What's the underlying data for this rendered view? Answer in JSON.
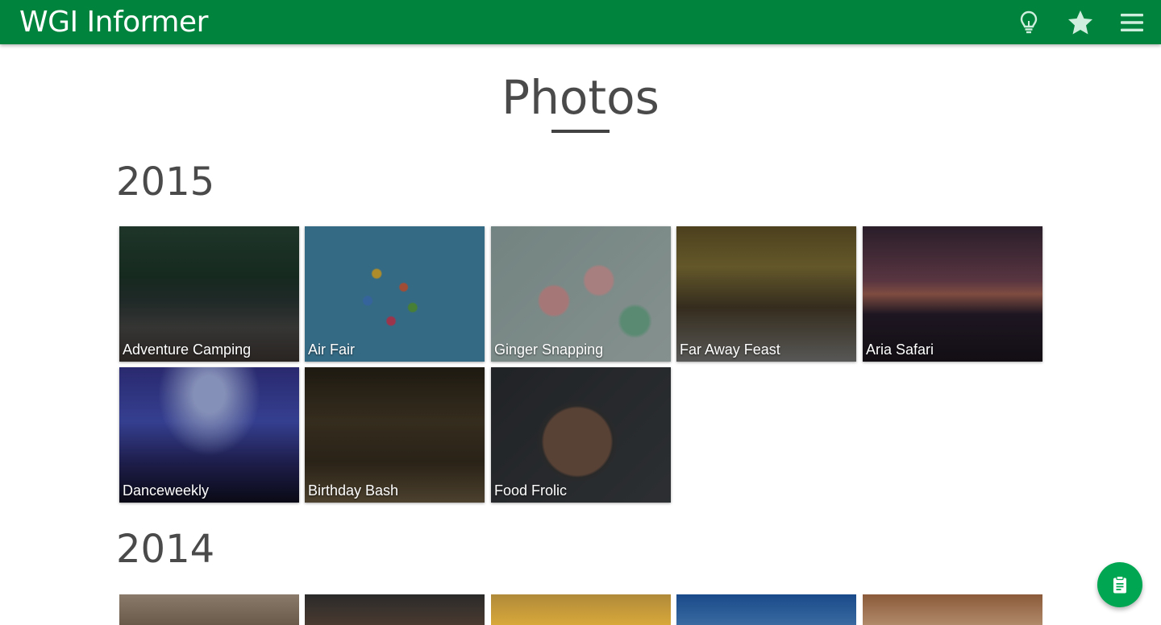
{
  "app": {
    "title": "WGI Informer",
    "accent": "#00843d",
    "icons": [
      "lightbulb-icon",
      "star-icon",
      "menu-icon"
    ]
  },
  "page": {
    "title": "Photos"
  },
  "sections": [
    {
      "year": "2015",
      "albums": [
        {
          "label": "Adventure Camping"
        },
        {
          "label": "Air Fair"
        },
        {
          "label": "Ginger Snapping"
        },
        {
          "label": "Far Away Feast"
        },
        {
          "label": "Aria Safari"
        },
        {
          "label": "Danceweekly"
        },
        {
          "label": "Birthday Bash"
        },
        {
          "label": "Food Frolic"
        }
      ]
    },
    {
      "year": "2014",
      "albums": []
    }
  ],
  "fab": {
    "icon": "clipboard-icon",
    "color": "#00a651"
  }
}
